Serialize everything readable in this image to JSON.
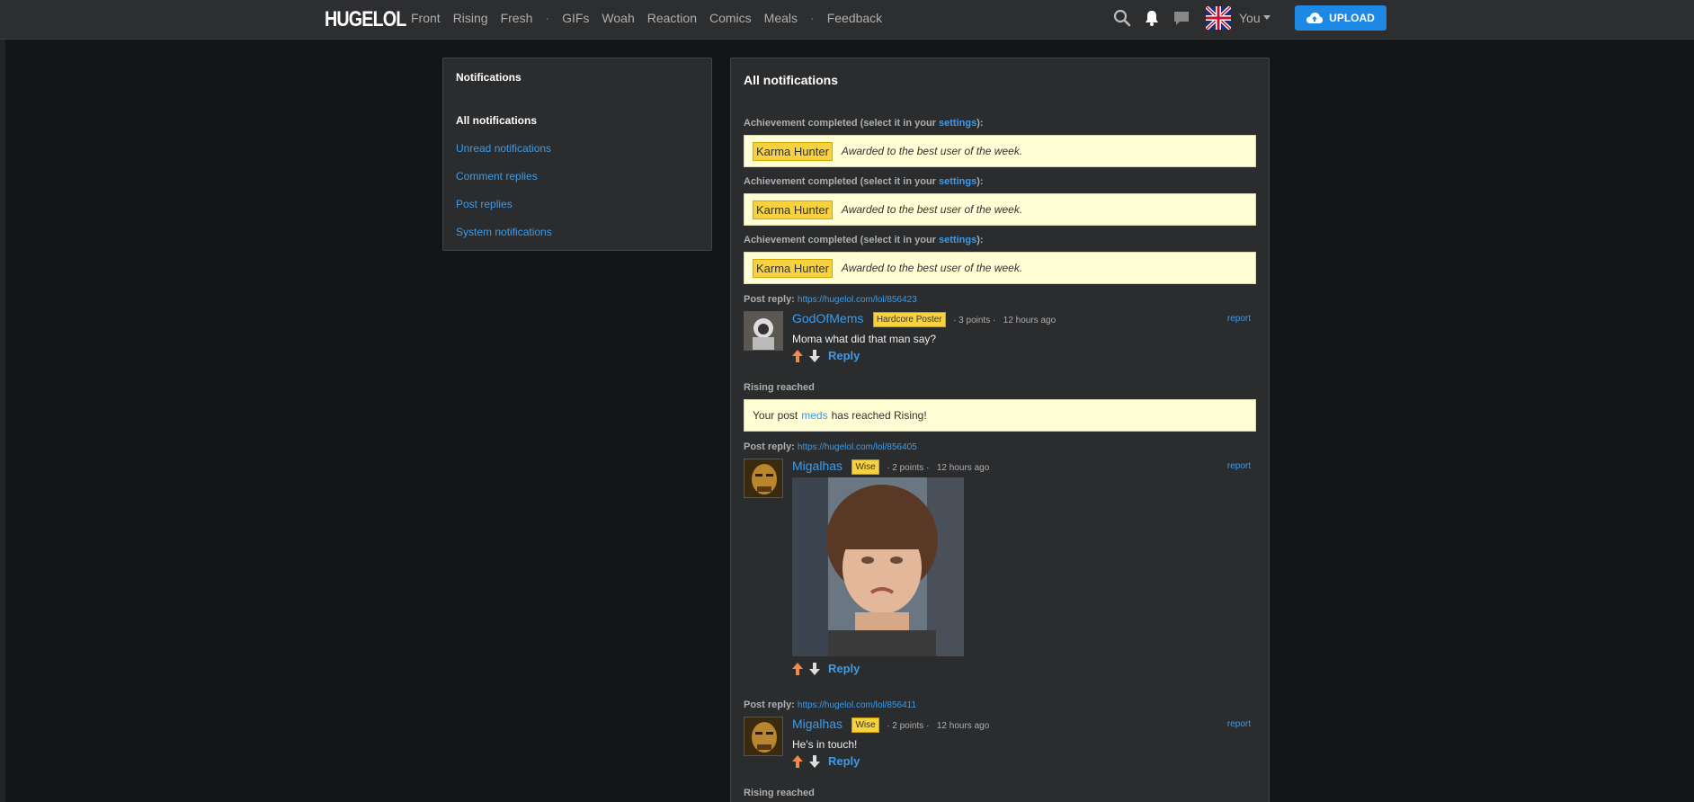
{
  "nav": {
    "logo": "HUGELOL",
    "items": [
      "Front",
      "Rising",
      "Fresh",
      "GIFs",
      "Woah",
      "Reaction",
      "Comics",
      "Meals",
      "Feedback"
    ],
    "separator": "·",
    "user_label": "You",
    "upload_label": "UPLOAD",
    "icons": [
      "search-icon",
      "bell-icon",
      "chat-icon"
    ]
  },
  "sidebar": {
    "title": "Notifications",
    "links": [
      "All notifications",
      "Unread notifications",
      "Comment replies",
      "Post replies",
      "System notifications"
    ]
  },
  "main": {
    "title": "All notifications",
    "achievements": [
      {
        "prefix": "Achievement completed (select it in your ",
        "link": "settings",
        "suffix": "):",
        "badge": "Karma Hunter",
        "desc": "Awarded to the best user of the week."
      },
      {
        "prefix": "Achievement completed (select it in your ",
        "link": "settings",
        "suffix": "):",
        "badge": "Karma Hunter",
        "desc": "Awarded to the best user of the week."
      },
      {
        "prefix": "Achievement completed (select it in your ",
        "link": "settings",
        "suffix": "):",
        "badge": "Karma Hunter",
        "desc": "Awarded to the best user of the week."
      }
    ],
    "replies": [
      {
        "label": "Post reply:",
        "url": "https://hugelol.com/lol/856423",
        "user": "GodOfMems",
        "rank": "Hardcore Poster",
        "points": "· 3 points ·",
        "time": "12 hours ago",
        "text": "Moma what did that man say?",
        "report": "report",
        "reply": "Reply"
      },
      {
        "label": "Post reply:",
        "url": "https://hugelol.com/lol/856405",
        "user": "Migalhas",
        "rank": "Wise",
        "points": "· 2 points ·",
        "time": "12 hours ago",
        "text": "",
        "report": "report",
        "reply": "Reply"
      },
      {
        "label": "Post reply:",
        "url": "https://hugelol.com/lol/856411",
        "user": "Migalhas",
        "rank": "Wise",
        "points": "· 2 points ·",
        "time": "12 hours ago",
        "text": "He's in touch!",
        "report": "report",
        "reply": "Reply"
      }
    ],
    "rising": {
      "title": "Rising reached",
      "prefix": "Your post",
      "link": "meds",
      "suffix": "has reached Rising!"
    },
    "rising_bottom_title": "Rising reached"
  },
  "colors": {
    "accent": "#3d9be9",
    "upload": "#1e88e5",
    "badge": "#f7d23e",
    "panel": "#2b2c2e",
    "bg": "#141517"
  }
}
